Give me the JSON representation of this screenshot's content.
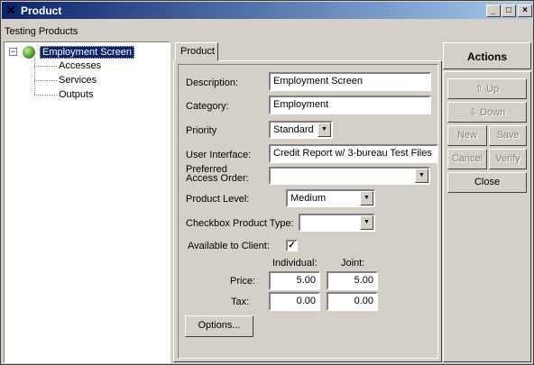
{
  "window": {
    "title": "Product",
    "subtitle": "Testing Products",
    "controls": {
      "minimize": "_",
      "maximize": "□",
      "close": "×"
    },
    "icon": "x-icon"
  },
  "tree": {
    "root": {
      "label": "Employment Screen",
      "toggle": "−"
    },
    "children": [
      "Accesses",
      "Services",
      "Outputs"
    ]
  },
  "tabs": [
    {
      "label": "Product"
    }
  ],
  "form": {
    "description": {
      "label": "Description:",
      "value": "Employment Screen"
    },
    "category": {
      "label": "Category:",
      "value": "Employment"
    },
    "priority": {
      "label": "Priority",
      "value": "Standard"
    },
    "user_interface": {
      "label": "User Interface:",
      "value": "Credit Report w/ 3-bureau Test Files"
    },
    "preferred_access_order": {
      "label_line1": "Preferred",
      "label_line2": "Access Order:",
      "value": ""
    },
    "product_level": {
      "label": "Product Level:",
      "value": "Medium"
    },
    "checkbox_product_type": {
      "label": "Checkbox Product Type:",
      "value": ""
    },
    "available_to_client": {
      "label": "Available to Client:",
      "checked": true,
      "mark": "✓"
    },
    "pricing": {
      "individual_header": "Individual:",
      "joint_header": "Joint:",
      "price": {
        "label": "Price:",
        "individual": "5.00",
        "joint": "5.00"
      },
      "tax": {
        "label": "Tax:",
        "individual": "0.00",
        "joint": "0.00"
      }
    },
    "options_button": "Options..."
  },
  "actions": {
    "title": "Actions",
    "up": {
      "label": "Up",
      "icon": "arrow-up-icon",
      "glyph": "⇧",
      "enabled": false
    },
    "down": {
      "label": "Down",
      "icon": "arrow-down-icon",
      "glyph": "⇩",
      "enabled": false
    },
    "new": {
      "label": "New",
      "enabled": false
    },
    "save": {
      "label": "Save",
      "enabled": false
    },
    "cancel": {
      "label": "Cancel",
      "enabled": false
    },
    "verify": {
      "label": "Verify",
      "enabled": false
    },
    "close": {
      "label": "Close",
      "enabled": true
    }
  },
  "colors": {
    "titlebar_start": "#0a246a",
    "titlebar_end": "#a6caf0",
    "selection": "#0a246a",
    "face": "#d4d0c8"
  }
}
